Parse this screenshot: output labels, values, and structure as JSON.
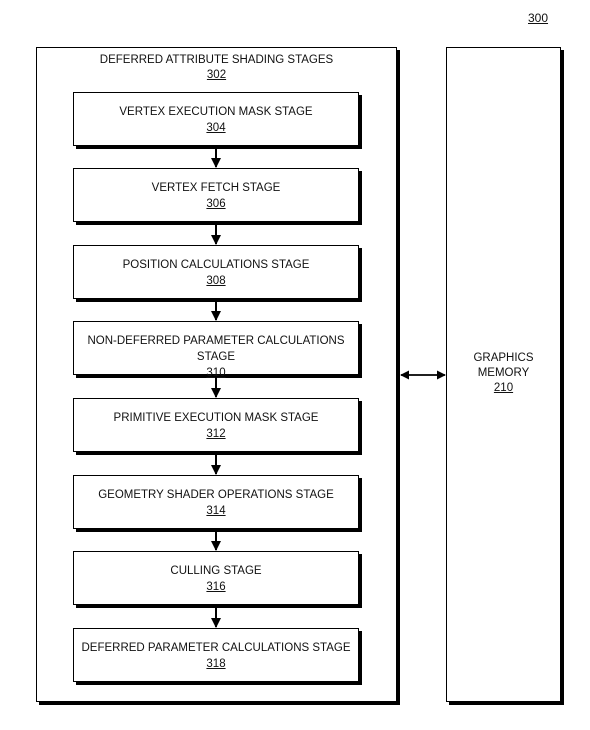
{
  "figure": {
    "number": "300"
  },
  "outer_group": {
    "title": "DEFERRED ATTRIBUTE SHADING STAGES",
    "ref": "302"
  },
  "memory": {
    "line1": "GRAPHICS",
    "line2": "MEMORY",
    "ref": "210"
  },
  "stages": [
    {
      "label": "VERTEX EXECUTION MASK STAGE",
      "ref": "304"
    },
    {
      "label": "VERTEX FETCH STAGE",
      "ref": "306"
    },
    {
      "label": "POSITION CALCULATIONS STAGE",
      "ref": "308"
    },
    {
      "label": "NON-DEFERRED PARAMETER CALCULATIONS STAGE",
      "ref": "310"
    },
    {
      "label": "PRIMITIVE EXECUTION MASK STAGE",
      "ref": "312"
    },
    {
      "label": "GEOMETRY SHADER OPERATIONS STAGE",
      "ref": "314"
    },
    {
      "label": "CULLING STAGE",
      "ref": "316"
    },
    {
      "label": "DEFERRED PARAMETER CALCULATIONS STAGE",
      "ref": "318"
    }
  ],
  "connections": [
    {
      "from": "304",
      "to": "306",
      "type": "one-way"
    },
    {
      "from": "306",
      "to": "308",
      "type": "one-way"
    },
    {
      "from": "308",
      "to": "310",
      "type": "one-way"
    },
    {
      "from": "310",
      "to": "312",
      "type": "one-way"
    },
    {
      "from": "312",
      "to": "314",
      "type": "one-way"
    },
    {
      "from": "314",
      "to": "316",
      "type": "one-way"
    },
    {
      "from": "316",
      "to": "318",
      "type": "one-way"
    },
    {
      "from": "302",
      "to": "210",
      "type": "bidirectional"
    }
  ]
}
